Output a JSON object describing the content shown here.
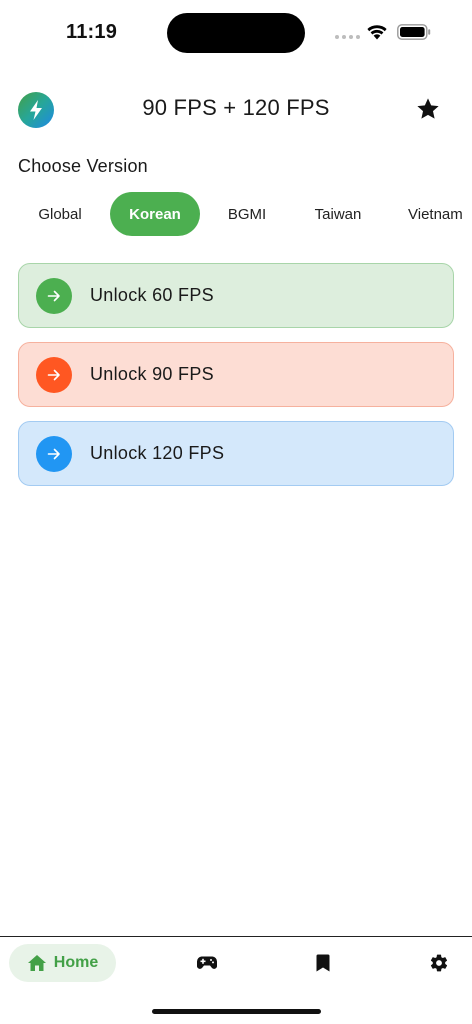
{
  "status_bar": {
    "time": "11:19",
    "icons": [
      "signal-dots-icon",
      "wifi-icon",
      "battery-icon"
    ]
  },
  "header": {
    "logo_icon": "lightning-bolt-icon",
    "title": "90 FPS + 120 FPS",
    "favorite_icon": "star-icon"
  },
  "version_section": {
    "label": "Choose Version",
    "selected": "Korean",
    "options": [
      "Global",
      "Korean",
      "BGMI",
      "Taiwan",
      "Vietnam"
    ]
  },
  "unlock_options": [
    {
      "label": "Unlock 60 FPS",
      "icon": "arrow-right-icon",
      "color": "#4caf50"
    },
    {
      "label": "Unlock 90 FPS",
      "icon": "arrow-right-icon",
      "color": "#ff5722"
    },
    {
      "label": "Unlock 120 FPS",
      "icon": "arrow-right-icon",
      "color": "#2196f3"
    }
  ],
  "bottom_nav": {
    "home_label": "Home",
    "active": "Home",
    "items": [
      "home-icon",
      "gamepad-icon",
      "bookmark-icon",
      "settings-icon"
    ]
  },
  "colors": {
    "accent": "#4caf50",
    "green_card_bg": "#ddeedd",
    "orange_card_bg": "#fdddd4",
    "blue_card_bg": "#d4e8fb"
  }
}
